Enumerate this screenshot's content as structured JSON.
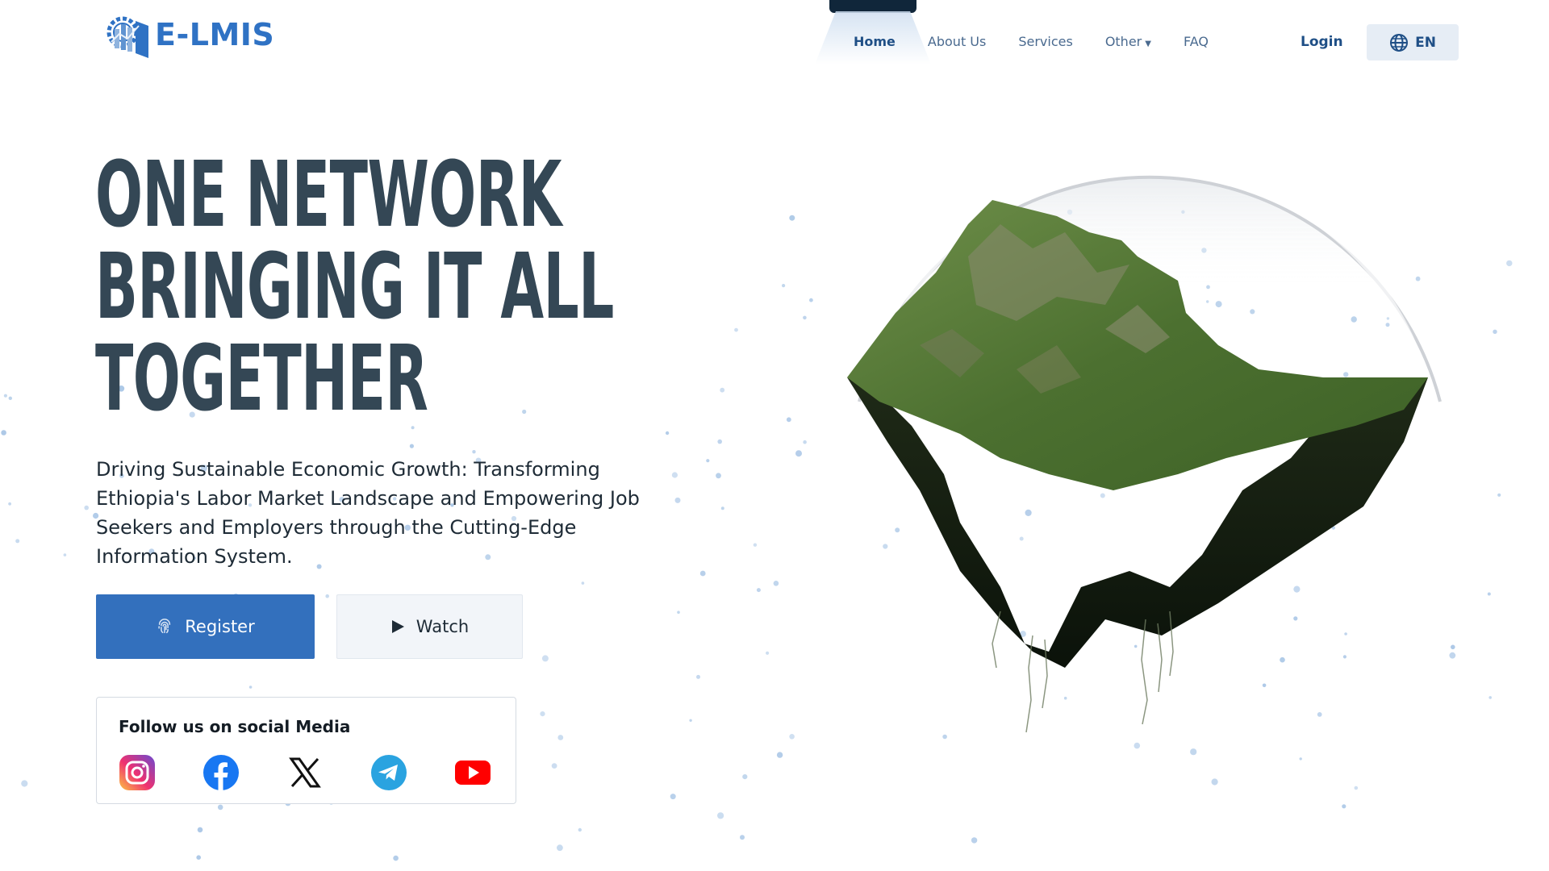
{
  "brand": {
    "logo_text": "E-LMIS",
    "accent": "#2f72c4"
  },
  "nav": {
    "items": [
      {
        "label": "Home",
        "active": true
      },
      {
        "label": "About Us",
        "active": false
      },
      {
        "label": "Services",
        "active": false
      },
      {
        "label": "Other",
        "active": false,
        "has_dropdown": true
      },
      {
        "label": "FAQ",
        "active": false
      }
    ],
    "login_label": "Login",
    "language": {
      "label": "EN",
      "icon": "globe-icon"
    }
  },
  "hero": {
    "headline_lines": [
      "ONE NETWORK",
      "BRINGING IT ALL",
      "TOGETHER"
    ],
    "subtitle": "Driving Sustainable Economic Growth: Transforming Ethiopia's Labor Market Landscape and Empowering Job Seekers and Employers through the Cutting-Edge Information System.",
    "register_label": "Register",
    "register_icon": "fingerprint-icon",
    "watch_label": "Watch",
    "watch_icon": "play-icon"
  },
  "social": {
    "title": "Follow us on social Media",
    "icons": [
      "instagram-icon",
      "facebook-icon",
      "x-icon",
      "telegram-icon",
      "youtube-icon"
    ]
  },
  "colors": {
    "primary_button": "#3370bd",
    "headline": "#344755",
    "nav_active": "#1f4f86",
    "nav_text": "#4a6a8f"
  }
}
